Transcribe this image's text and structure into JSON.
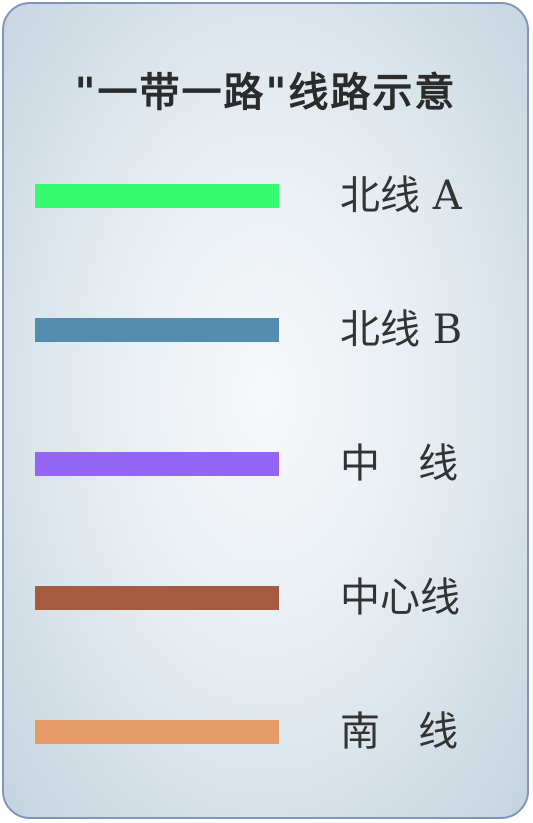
{
  "legend": {
    "title": "\"一带一路\"线路示意",
    "items": [
      {
        "label": "北线 A",
        "color": "#35fb6e"
      },
      {
        "label": "北线 B",
        "color": "#548daf"
      },
      {
        "label": "中   线",
        "color": "#9566f5"
      },
      {
        "label": "中心线",
        "color": "#a45b40"
      },
      {
        "label": "南   线",
        "color": "#e69b66"
      }
    ]
  }
}
